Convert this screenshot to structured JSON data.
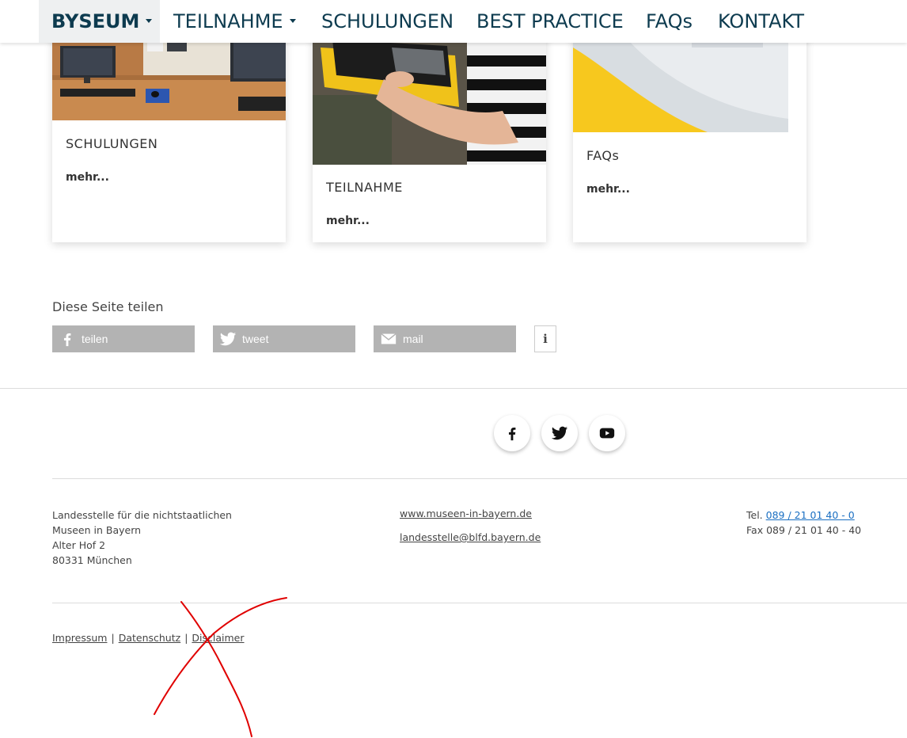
{
  "nav": {
    "items": [
      {
        "label": "BYSEUM",
        "active": true,
        "has_caret": true
      },
      {
        "label": "TEILNAHME",
        "has_caret": true
      },
      {
        "label": "SCHULUNGEN"
      },
      {
        "label": "BEST PRACTICE"
      },
      {
        "label": "FAQs"
      },
      {
        "label": "KONTAKT"
      }
    ]
  },
  "cards": [
    {
      "title": "SCHULUNGEN",
      "more": "mehr..."
    },
    {
      "title": "TEILNAHME",
      "more": "mehr..."
    },
    {
      "title": "FAQs",
      "more": "mehr..."
    }
  ],
  "share": {
    "label": "Diese Seite teilen",
    "facebook": "teilen",
    "twitter": "tweet",
    "mail": "mail",
    "info": "i"
  },
  "footer": {
    "address": [
      "Landesstelle für die nichtstaatlichen",
      "Museen in Bayern",
      "Alter Hof 2",
      "80331 München"
    ],
    "website": "www.museen-in-bayern.de",
    "email": "landesstelle@blfd.bayern.de",
    "tel_prefix": "Tel.",
    "tel": "089 / 21 01 40 - 0",
    "fax": "Fax 089 / 21 01 40 - 40",
    "legal": [
      "Impressum",
      "Datenschutz",
      "Disclaimer"
    ],
    "separator": "|"
  },
  "colors": {
    "nav_text": "#0d3b4f",
    "share_bg": "#b3b3b3",
    "link_blue": "#1a6fc2",
    "scribble": "#e00000"
  }
}
